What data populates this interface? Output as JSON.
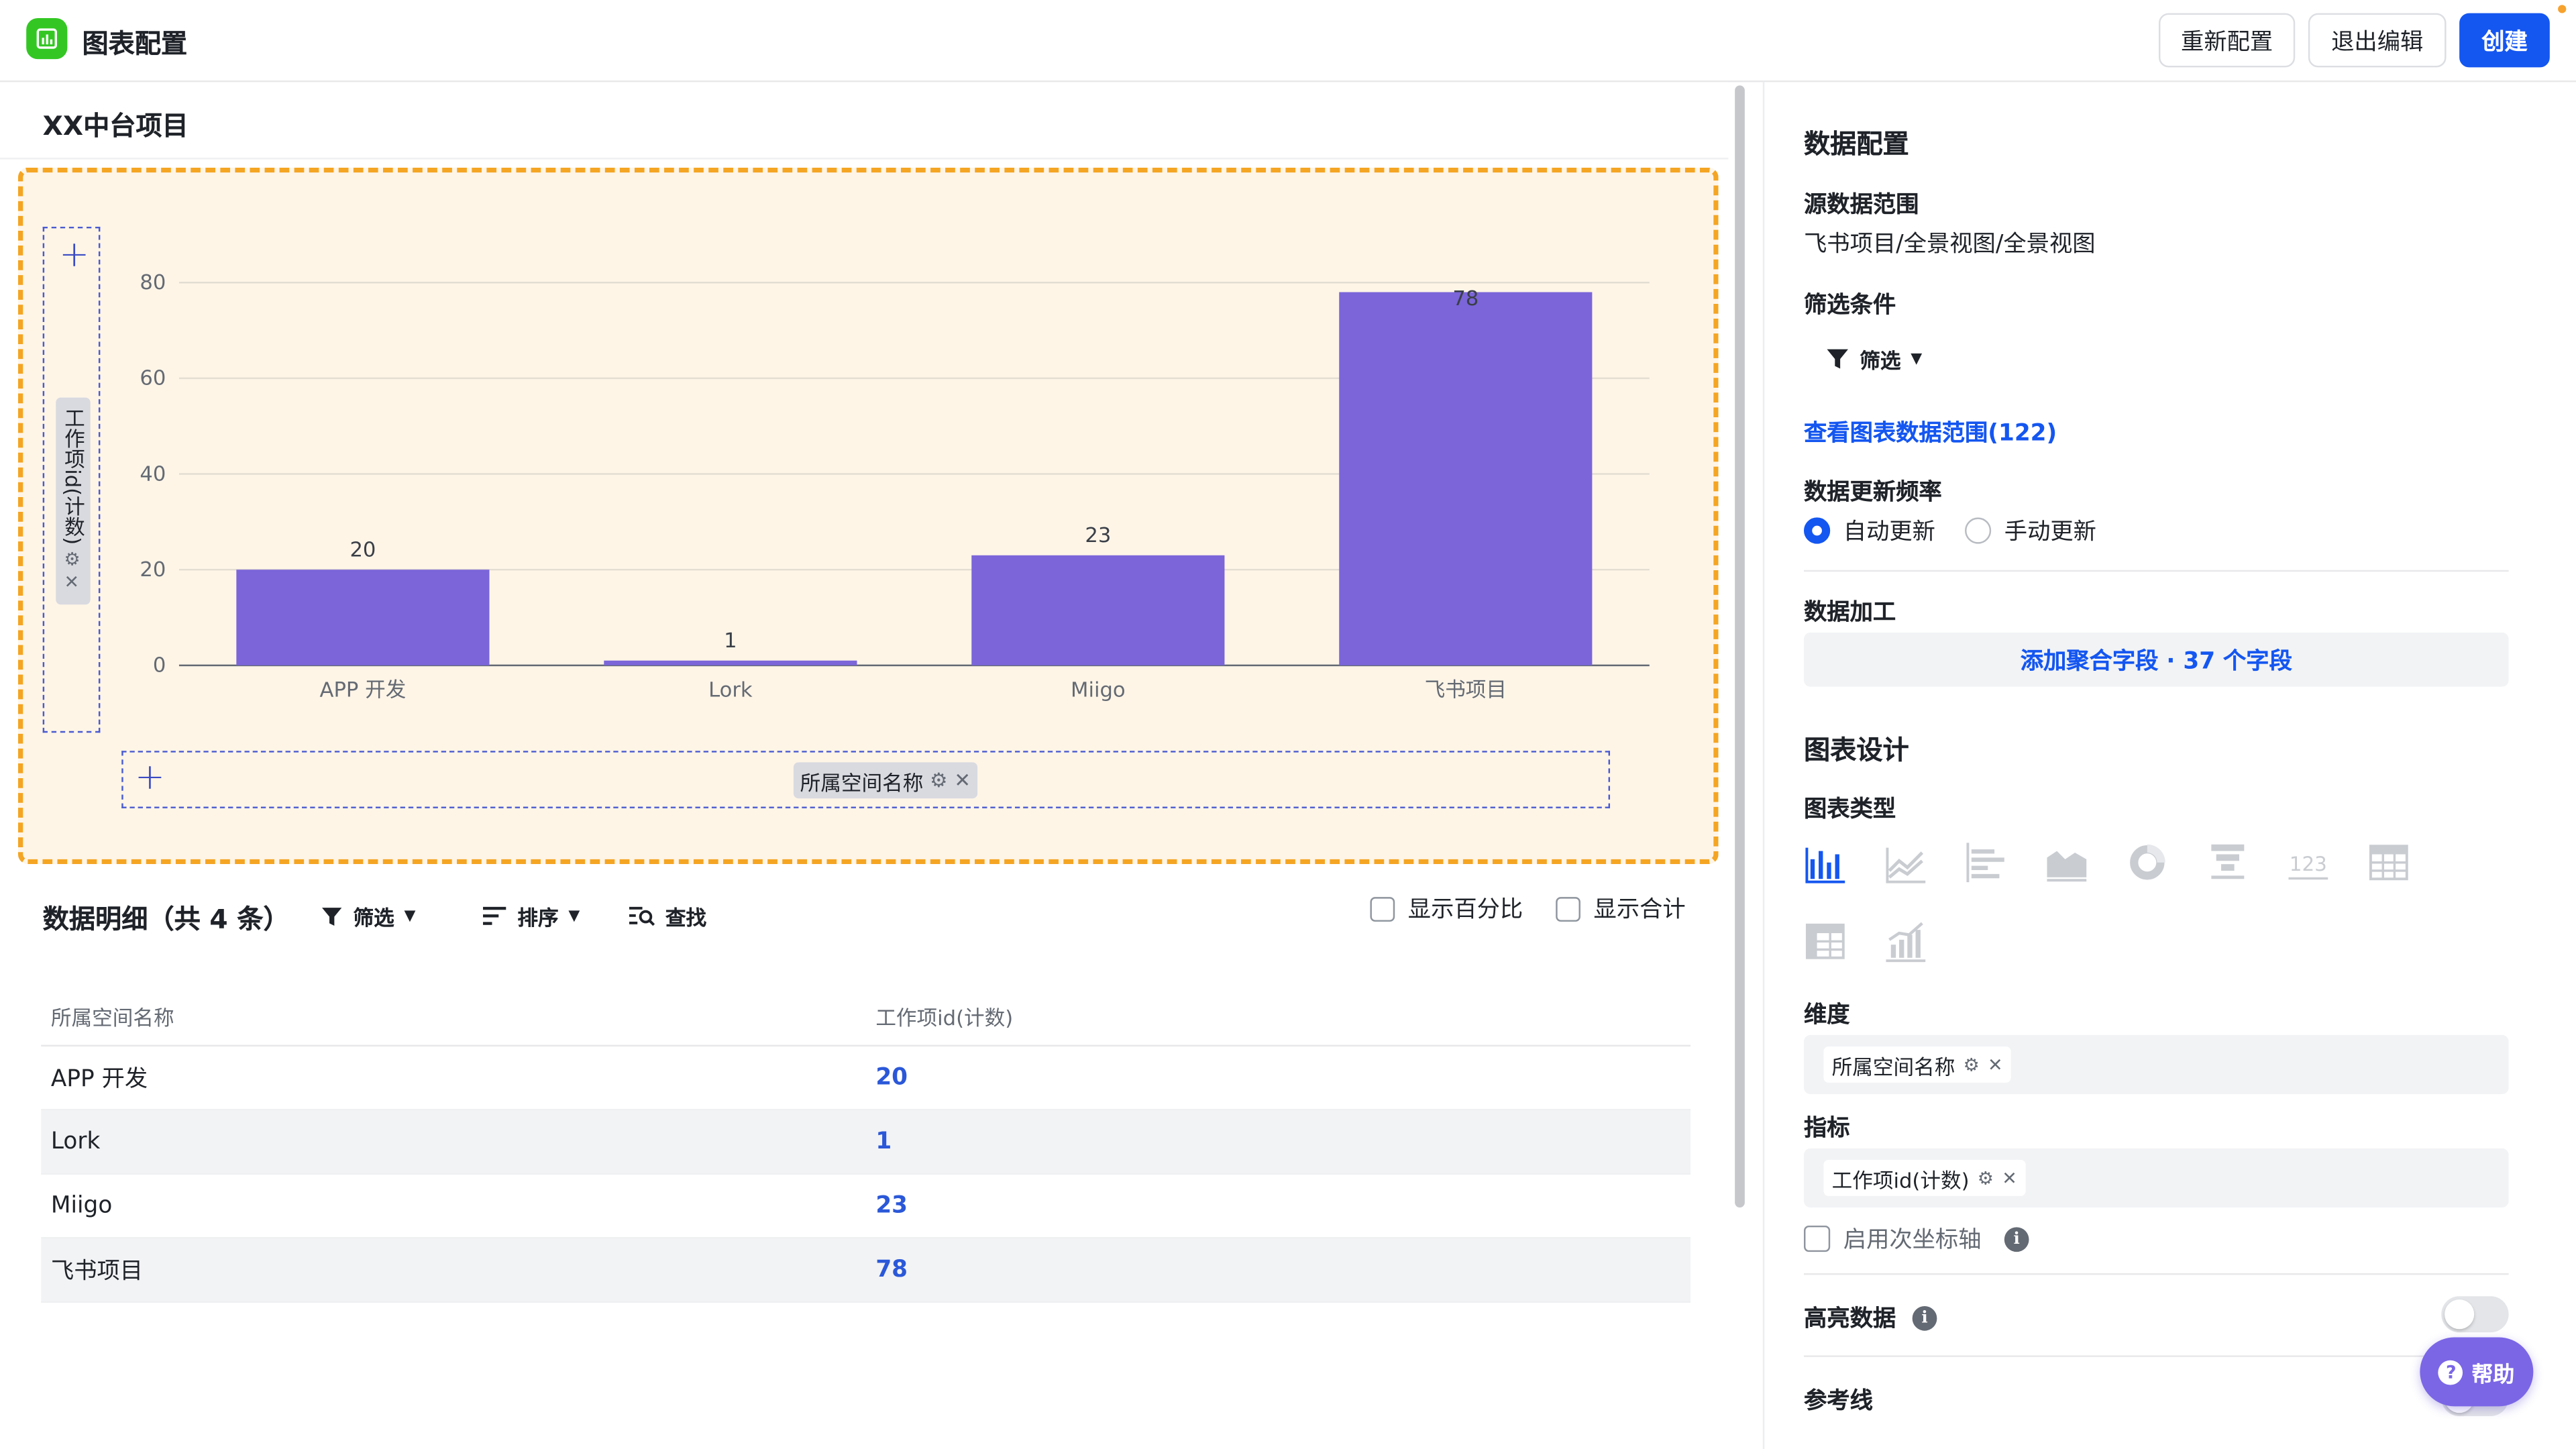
{
  "header": {
    "app_title": "图表配置",
    "reset_label": "重新配置",
    "exit_label": "退出编辑",
    "create_label": "创建"
  },
  "chart_panel": {
    "project_title": "XX中台项目",
    "y_field_label": "工作项id(计数)",
    "x_field_label": "所属空间名称"
  },
  "chart_data": {
    "type": "bar",
    "categories": [
      "APP 开发",
      "Lork",
      "Miigo",
      "飞书项目"
    ],
    "values": [
      20,
      1,
      23,
      78
    ],
    "data_labels": [
      "20",
      "1",
      "23",
      "78"
    ],
    "title": "",
    "xlabel": "",
    "ylabel": "",
    "ylim": [
      0,
      80
    ],
    "yticks": [
      "0",
      "20",
      "40",
      "60",
      "80"
    ],
    "grid": true,
    "bar_color": "#7b65d9"
  },
  "detail": {
    "title": "数据明细（共 4 条）",
    "filter_label": "筛选",
    "sort_label": "排序",
    "find_label": "查找",
    "show_percent_label": "显示百分比",
    "show_total_label": "显示合计",
    "columns": [
      "所属空间名称",
      "工作项id(计数)"
    ],
    "rows": [
      {
        "name": "APP 开发",
        "value": "20"
      },
      {
        "name": "Lork",
        "value": "1"
      },
      {
        "name": "Miigo",
        "value": "23"
      },
      {
        "name": "飞书项目",
        "value": "78"
      }
    ]
  },
  "config": {
    "data_config_title": "数据配置",
    "source_label": "源数据范围",
    "source_value": "飞书项目/全景视图/全景视图",
    "filter_cond_label": "筛选条件",
    "filter_button": "筛选",
    "view_range_link": "查看图表数据范围(122)",
    "update_freq_label": "数据更新频率",
    "auto_update": "自动更新",
    "manual_update": "手动更新",
    "processing_label": "数据加工",
    "add_agg_label": "添加聚合字段 · 37 个字段",
    "design_title": "图表设计",
    "chart_type_label": "图表类型",
    "dimension_label": "维度",
    "dimension_chip": "所属空间名称",
    "metric_label": "指标",
    "metric_chip": "工作项id(计数)",
    "secondary_axis_label": "启用次坐标轴",
    "highlight_label": "高亮数据",
    "reference_label": "参考线",
    "help_label": "帮助"
  },
  "colors": {
    "accent": "#1456f0",
    "bar": "#7b65d9",
    "chart_bg": "#fef5e7",
    "chart_border": "#f4a523"
  }
}
